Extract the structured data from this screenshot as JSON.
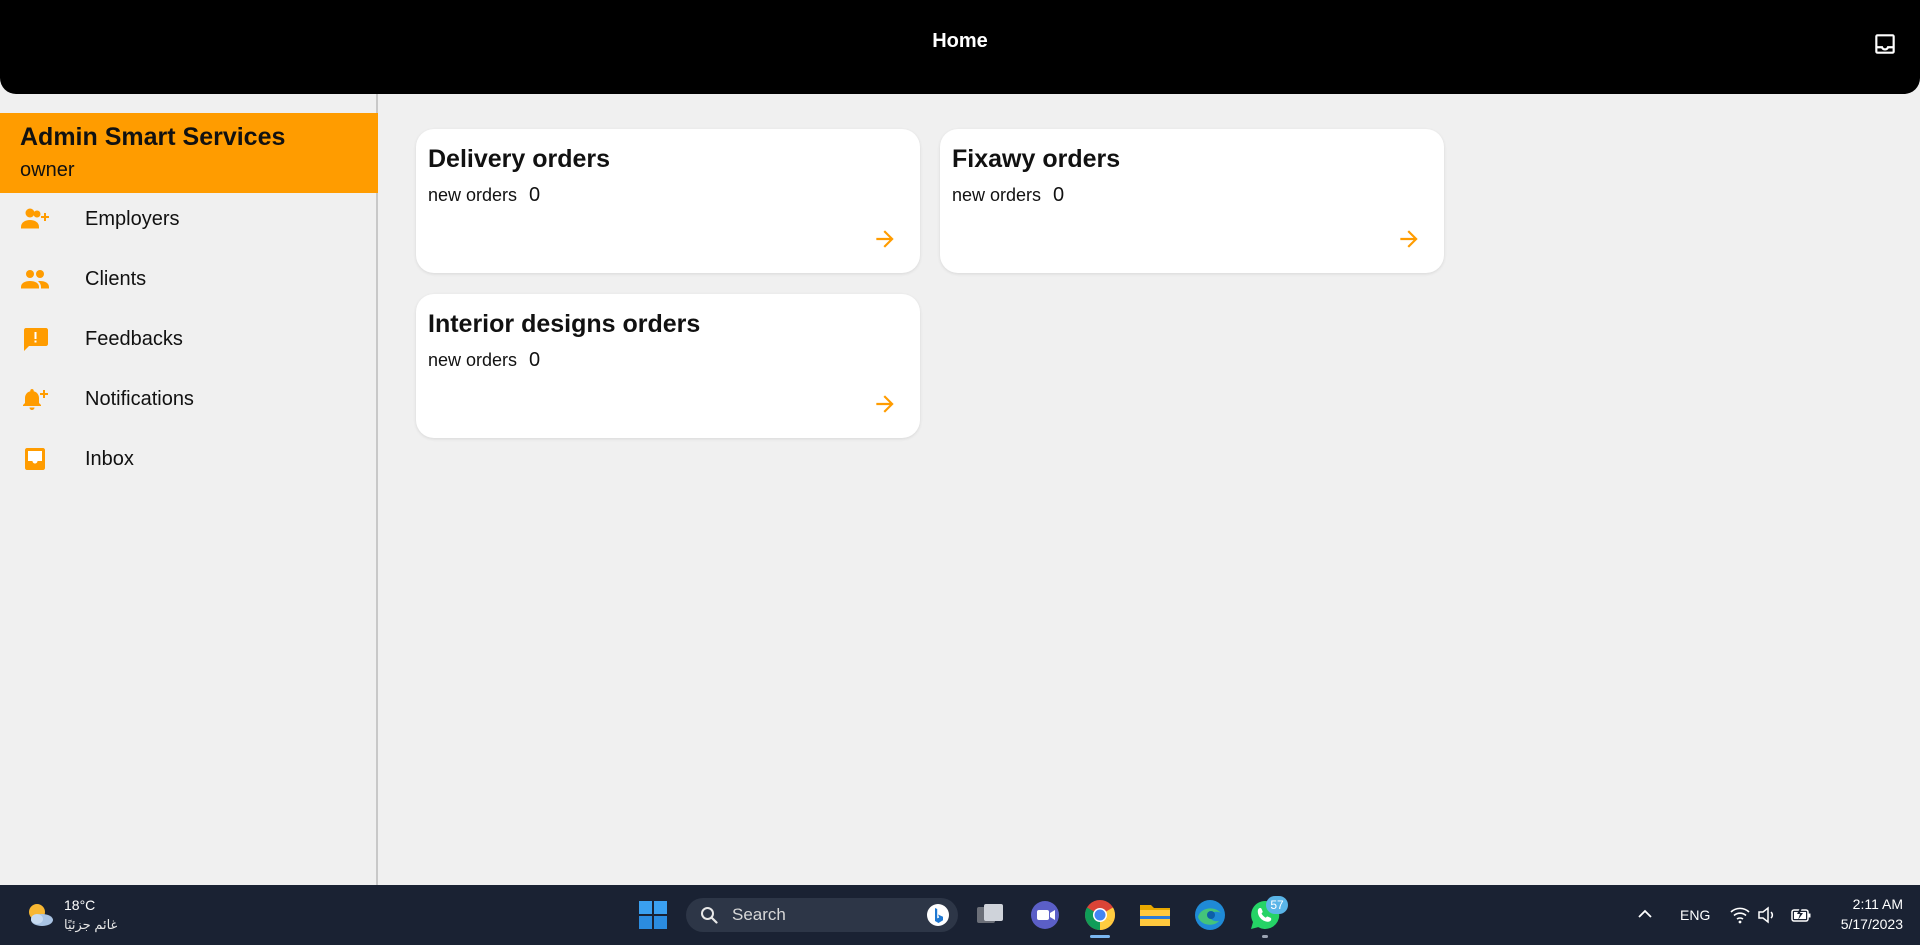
{
  "appbar": {
    "title": "Home",
    "action_icon": "inbox-icon"
  },
  "sidebar": {
    "header": {
      "title": "Admin Smart Services",
      "subtitle": "owner"
    },
    "items": [
      {
        "label": "Employers",
        "icon": "add-user-icon"
      },
      {
        "label": "Clients",
        "icon": "people-icon"
      },
      {
        "label": "Feedbacks",
        "icon": "feedback-icon"
      },
      {
        "label": "Notifications",
        "icon": "add-alert-icon"
      },
      {
        "label": "Inbox",
        "icon": "inbox-icon"
      }
    ]
  },
  "cards": [
    {
      "title": "Delivery orders",
      "new_label": "new orders",
      "count": "0"
    },
    {
      "title": "Fixawy orders",
      "new_label": "new orders",
      "count": "0"
    },
    {
      "title": "Interior designs orders",
      "new_label": "new orders",
      "count": "0"
    }
  ],
  "taskbar": {
    "weather": {
      "temp": "18°C",
      "desc": "غائم جزئيًا"
    },
    "search": {
      "placeholder": "Search"
    },
    "apps": [
      "start",
      "task-view",
      "teams",
      "chrome",
      "file-explorer",
      "edge",
      "whatsapp"
    ],
    "whatsapp_badge": "57",
    "tray": {
      "lang": "ENG"
    },
    "clock": {
      "time": "2:11 AM",
      "date": "5/17/2023"
    }
  },
  "colors": {
    "accent": "#ff9c00",
    "appbar": "#000000",
    "background": "#f0f0f0",
    "card": "#ffffff",
    "taskbar": "#1a2233"
  }
}
